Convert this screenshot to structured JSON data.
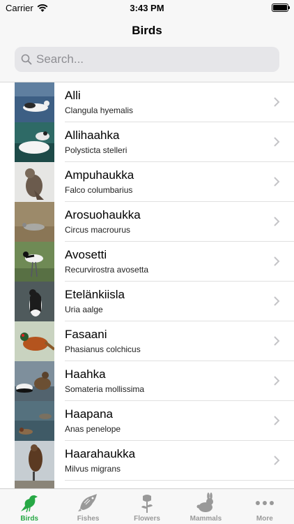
{
  "status_bar": {
    "carrier": "Carrier",
    "time": "3:43 PM"
  },
  "nav": {
    "title": "Birds",
    "search_placeholder": "Search..."
  },
  "birds": [
    {
      "name": "Alli",
      "latin": "Clangula hyemalis"
    },
    {
      "name": "Allihaahka",
      "latin": "Polysticta stelleri"
    },
    {
      "name": "Ampuhaukka",
      "latin": "Falco columbarius"
    },
    {
      "name": "Arosuohaukka",
      "latin": "Circus macrourus"
    },
    {
      "name": "Avosetti",
      "latin": "Recurvirostra avosetta"
    },
    {
      "name": "Etelänkiisla",
      "latin": "Uria aalge"
    },
    {
      "name": "Fasaani",
      "latin": "Phasianus colchicus"
    },
    {
      "name": "Haahka",
      "latin": "Somateria mollissima"
    },
    {
      "name": "Haapana",
      "latin": "Anas penelope"
    },
    {
      "name": "Haarahaukka",
      "latin": "Milvus migrans"
    }
  ],
  "tabs": [
    {
      "label": "Birds",
      "icon": "bird-icon",
      "active": true
    },
    {
      "label": "Fishes",
      "icon": "fish-icon",
      "active": false
    },
    {
      "label": "Flowers",
      "icon": "flower-icon",
      "active": false
    },
    {
      "label": "Mammals",
      "icon": "rabbit-icon",
      "active": false
    },
    {
      "label": "More",
      "icon": "more-icon",
      "active": false
    }
  ],
  "colors": {
    "accent": "#27a845",
    "inactive": "#999999"
  }
}
